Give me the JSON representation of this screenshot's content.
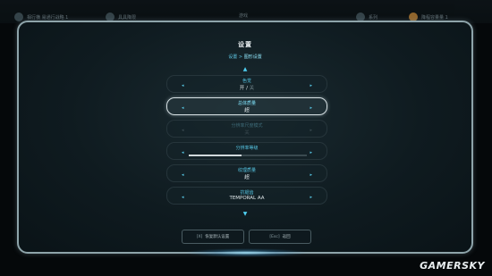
{
  "topbar": {
    "items": [
      {
        "label": "相行横 易通行战略 1"
      },
      {
        "label": "具具降限"
      },
      {
        "label": "游戏"
      },
      {
        "label": "系列"
      },
      {
        "label": "降程容量量 1"
      }
    ]
  },
  "dialog": {
    "title": "设置",
    "breadcrumb": {
      "parent": "设置",
      "separator": ">",
      "current": "图形设置"
    },
    "options": [
      {
        "label": "色觉",
        "value": "开",
        "separator": "/",
        "alt": "关",
        "left": "◂",
        "right": "▸"
      },
      {
        "label": "总体质量",
        "value": "超",
        "left": "◂",
        "right": "▸"
      },
      {
        "label": "分辨率尺度模式",
        "value": "关",
        "left": "◂",
        "right": "▸"
      },
      {
        "label": "分辨率等级",
        "slider": 0.45,
        "left": "◂",
        "right": "▸"
      },
      {
        "label": "纹理质量",
        "value": "超",
        "left": "◂",
        "right": "▸"
      },
      {
        "label": "抗锯齿",
        "value": "TEMPORAL AA",
        "left": "◂",
        "right": "▸"
      }
    ],
    "scroll_up": "▲",
    "scroll_down": "▼",
    "buttons": {
      "restore": {
        "key": "[X]",
        "label": "恢复默认设置"
      },
      "back": {
        "key": "[Esc]",
        "label": "返回"
      }
    }
  },
  "watermark": "GAMERSKY"
}
